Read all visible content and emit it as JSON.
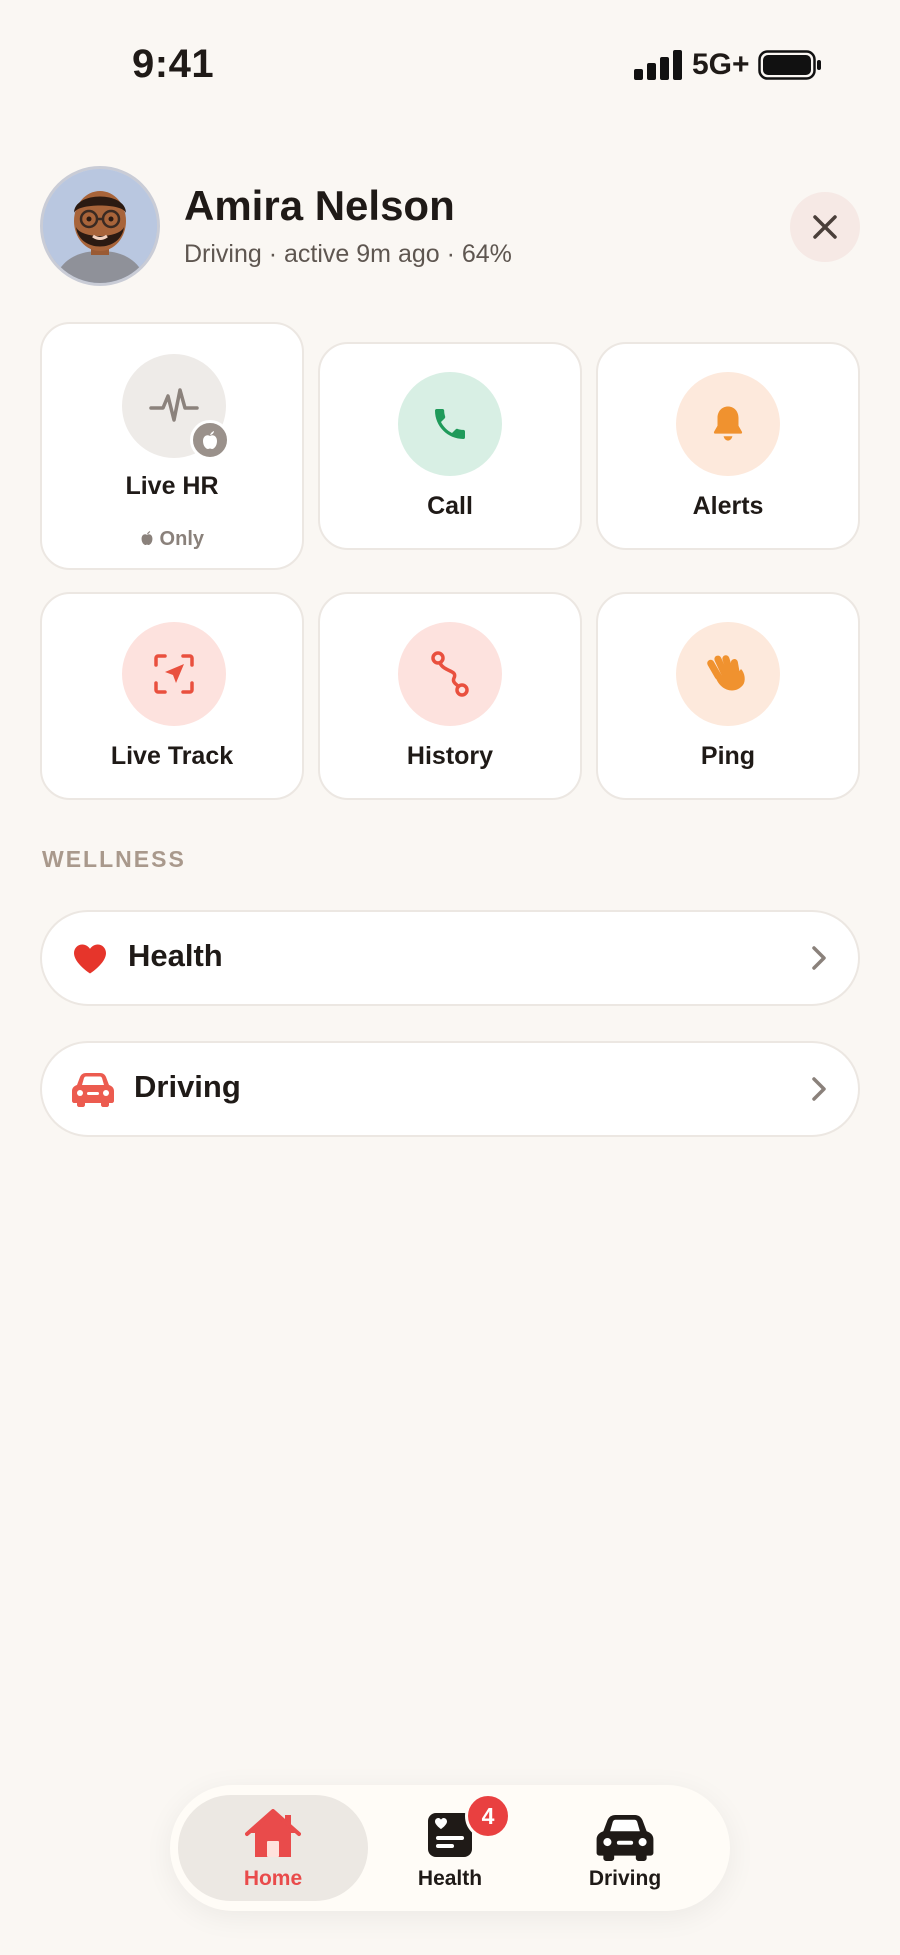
{
  "status_bar": {
    "time": "9:41",
    "network": "5G+"
  },
  "profile": {
    "name": "Amira Nelson",
    "subtitle": "Driving · active 9m ago · 64%"
  },
  "actions": [
    {
      "label": "Live HR",
      "sublabel": "Only",
      "icon": "heart-rate-icon",
      "circle_color": "#eeebe8",
      "icon_color": "#8b827c"
    },
    {
      "label": "Call",
      "icon": "phone-icon",
      "circle_color": "#d8efe4",
      "icon_color": "#1f9a5a"
    },
    {
      "label": "Alerts",
      "icon": "bell-icon",
      "circle_color": "#fde9dc",
      "icon_color": "#f0922f"
    },
    {
      "label": "Live Track",
      "icon": "location-arrow-icon",
      "circle_color": "#fde2de",
      "icon_color": "#e9503e"
    },
    {
      "label": "History",
      "icon": "route-icon",
      "circle_color": "#fde2de",
      "icon_color": "#e9503e"
    },
    {
      "label": "Ping",
      "icon": "waving-hand-icon",
      "circle_color": "#fde9dc",
      "icon_color": "#f0922f"
    }
  ],
  "wellness": {
    "section_title": "WELLNESS",
    "items": [
      {
        "label": "Health",
        "icon": "heart-icon",
        "icon_color": "#e6352b"
      },
      {
        "label": "Driving",
        "icon": "car-icon",
        "icon_color": "#ec5b4f"
      }
    ]
  },
  "tabbar": {
    "tabs": [
      {
        "label": "Home",
        "icon": "home-icon",
        "active": true
      },
      {
        "label": "Health",
        "icon": "health-card-icon",
        "badge": "4"
      },
      {
        "label": "Driving",
        "icon": "car-icon"
      }
    ]
  },
  "colors": {
    "background": "#faf7f3",
    "accent": "#e94b4b",
    "badge": "#e94040"
  }
}
